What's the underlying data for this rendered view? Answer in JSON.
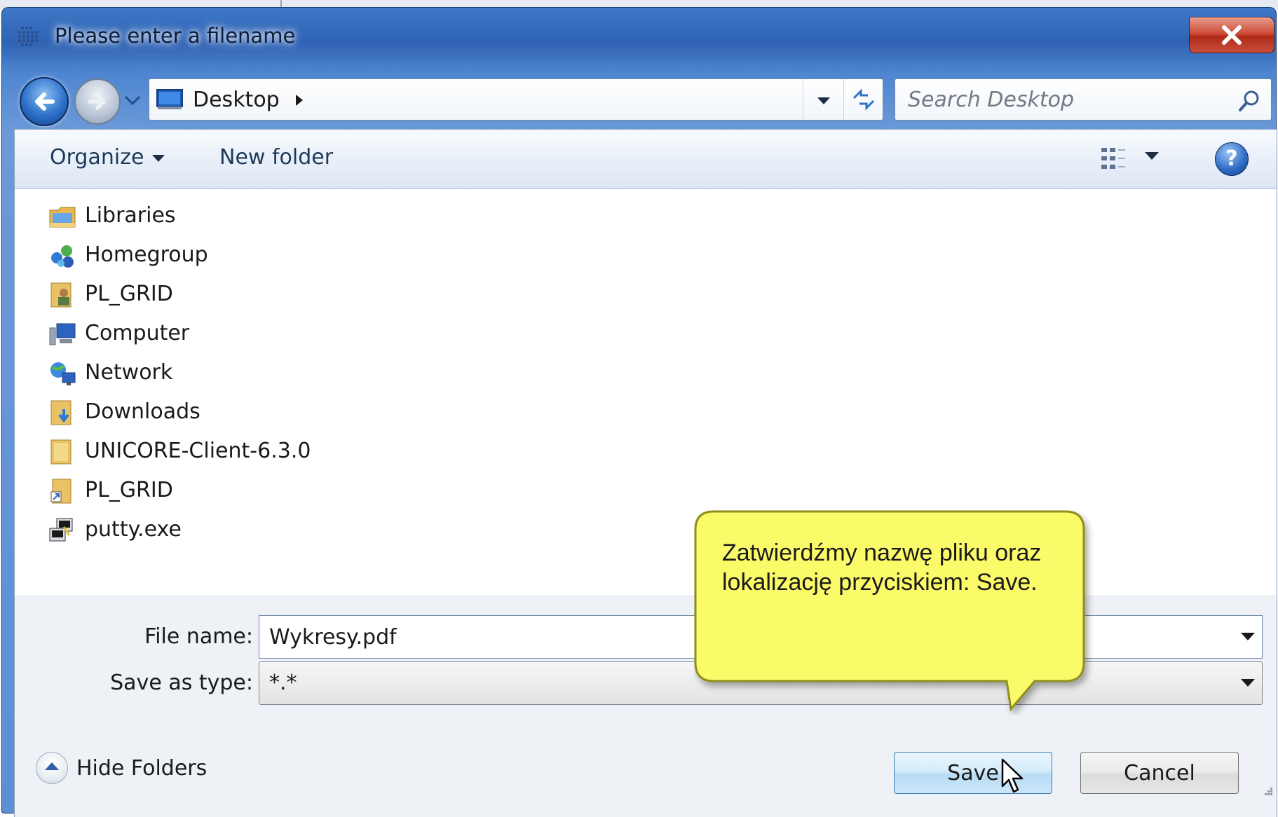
{
  "window": {
    "title": "Please enter a filename",
    "close_label": "close"
  },
  "navigation": {
    "location": "Desktop",
    "search_placeholder": "Search Desktop"
  },
  "toolbar": {
    "organize_label": "Organize",
    "new_folder_label": "New folder",
    "help_label": "?"
  },
  "files": [
    {
      "label": "Libraries",
      "icon": "libraries-icon"
    },
    {
      "label": "Homegroup",
      "icon": "homegroup-icon"
    },
    {
      "label": "PL_GRID",
      "icon": "user-folder-icon"
    },
    {
      "label": "Computer",
      "icon": "computer-icon"
    },
    {
      "label": "Network",
      "icon": "network-icon"
    },
    {
      "label": "Downloads",
      "icon": "downloads-folder-icon"
    },
    {
      "label": "UNICORE-Client-6.3.0",
      "icon": "folder-icon"
    },
    {
      "label": "PL_GRID",
      "icon": "shortcut-icon"
    },
    {
      "label": "putty.exe",
      "icon": "putty-icon"
    }
  ],
  "form": {
    "file_name_label": "File name:",
    "file_name_value": "Wykresy.pdf",
    "save_as_type_label": "Save as type:",
    "save_as_type_value": "*.*"
  },
  "footer": {
    "hide_folders_label": "Hide Folders",
    "save_label": "Save",
    "cancel_label": "Cancel"
  },
  "callout": {
    "text": "Zatwierdźmy nazwę pliku  oraz lokalizację przyciskiem: Save."
  },
  "colors": {
    "titlebar": "#3f78c7",
    "callout_fill": "#fbfb6a",
    "callout_border": "#8f8f1e",
    "save_button": "#cce6f9"
  }
}
